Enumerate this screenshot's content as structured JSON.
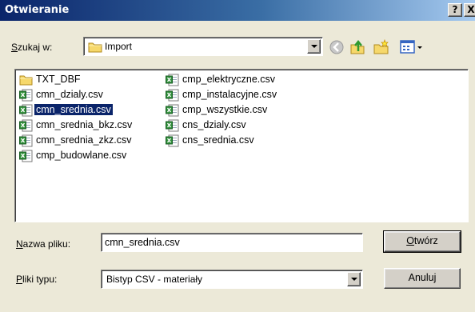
{
  "window": {
    "title": "Otwieranie"
  },
  "titlebar": {
    "help_label": "?",
    "close_label": "X"
  },
  "lookin": {
    "label_accel": "S",
    "label_rest": "zukaj w:",
    "value": "Import"
  },
  "toolbar": {
    "back": "back-arrow-icon",
    "up": "up-folder-icon",
    "new_folder": "new-folder-icon",
    "views": "views-menu-icon"
  },
  "files": {
    "col1": [
      "TXT_DBF",
      "cmn_dzialy.csv",
      "cmn_srednia.csv",
      "cmn_srednia_bkz.csv",
      "cmn_srednia_zkz.csv",
      "cmp_budowlane.csv"
    ],
    "col2": [
      "cmp_elektryczne.csv",
      "cmp_instalacyjne.csv",
      "cmp_wszystkie.csv",
      "cns_dzialy.csv",
      "cns_srednia.csv"
    ],
    "selected": "cmn_srednia.csv"
  },
  "filename": {
    "label_accel": "N",
    "label_rest": "azwa pliku:",
    "value": "cmn_srednia.csv"
  },
  "filetype": {
    "label_accel": "P",
    "label_rest": "liki typu:",
    "value": "Bistyp CSV - materiały"
  },
  "buttons": {
    "open_accel": "O",
    "open_rest": "twórz",
    "cancel": "Anuluj"
  },
  "colors": {
    "titlebar_start": "#0a246a",
    "titlebar_end": "#a6caf0",
    "selection": "#0a246a",
    "face": "#ece9d8"
  }
}
